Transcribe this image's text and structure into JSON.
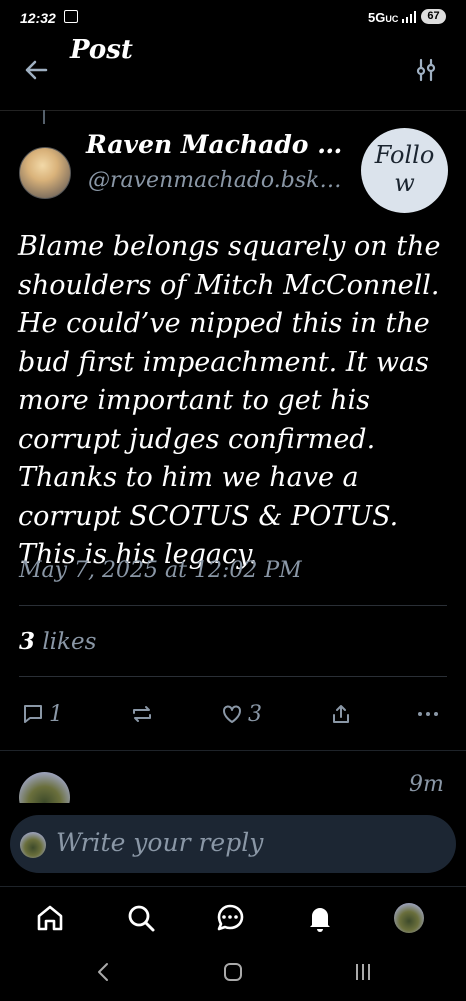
{
  "status_bar": {
    "time": "12:32",
    "network": "5G",
    "network_sub": "UC",
    "battery": "67"
  },
  "header": {
    "title": "Post",
    "back_icon": "arrow-left-icon",
    "filter_icon": "sliders-icon"
  },
  "post": {
    "author_name": "Raven Machado …",
    "author_handle": "@ravenmachado.bsky.social",
    "follow_label": "Follow",
    "follow_label_line1": "Follo",
    "follow_label_line2": "w",
    "text": "Blame belongs squarely on the shoulders of Mitch McConnell. He could’ve nipped this in the bud first impeachment. It was more important to get his corrupt judges confirmed. Thanks to him we have a corrupt SCOTUS & POTUS. This is his legacy.",
    "timestamp": "May 7, 2025 at 12:02 PM",
    "likes_count": "3",
    "likes_label": "likes",
    "actions": {
      "reply_count": "1",
      "like_count": "3"
    }
  },
  "reply_preview": {
    "time": "9m"
  },
  "composer": {
    "placeholder": "Write your reply"
  },
  "bottom_nav": {
    "items": [
      "home-icon",
      "search-icon",
      "chat-icon",
      "notifications-icon",
      "profile-avatar"
    ]
  },
  "colors": {
    "background": "#000000",
    "muted": "#8a97a6",
    "follow_bg": "#dbe3ec",
    "composer_bg": "#1c2633"
  }
}
